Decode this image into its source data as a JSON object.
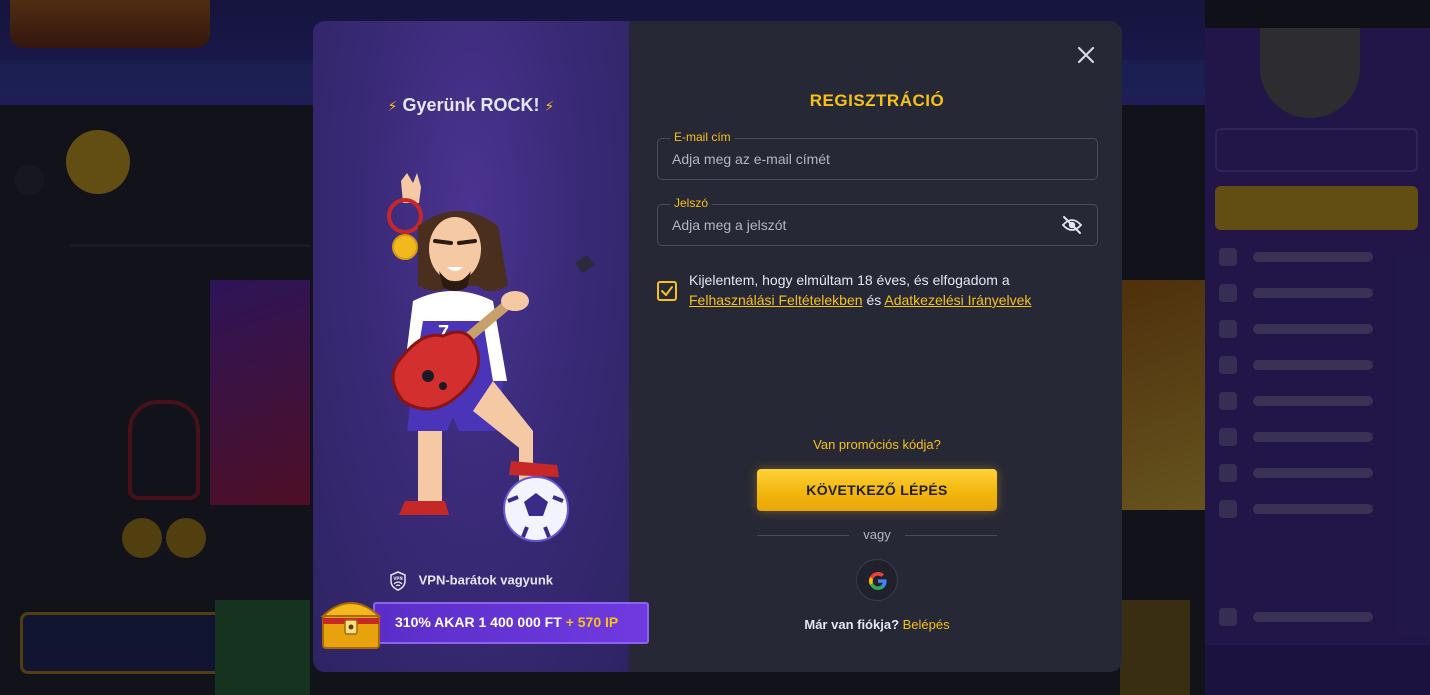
{
  "modal": {
    "close_icon": "close-icon",
    "promo": {
      "title": "Gyerünk ROCK!",
      "vpn_text": "VPN-barátok vagyunk",
      "vpn_icon_label": "VPN",
      "bonus_main": "310% AKAR 1 400 000 FT",
      "bonus_extra": "+ 570 IP"
    },
    "form": {
      "title": "REGISZTRÁCIÓ",
      "email": {
        "label": "E-mail cím",
        "placeholder": "Adja meg az e-mail címét"
      },
      "password": {
        "label": "Jelszó",
        "placeholder": "Adja meg a jelszót",
        "toggle_icon": "eye-off-icon"
      },
      "consent": {
        "checked": true,
        "text": "Kijelentem, hogy elmúltam 18 éves, és elfogadom a",
        "terms_link": "Felhasználási Feltételekben",
        "and": "és",
        "privacy_link": "Adatkezelési Irányelvek"
      },
      "promo_code_link": "Van promóciós kódja?",
      "next_button": "KÖVETKEZŐ LÉPÉS",
      "or_text": "vagy",
      "google_icon": "google-icon",
      "have_account": "Már van fiókja?",
      "login_link": "Belépés"
    }
  },
  "colors": {
    "accent": "#f6c21a",
    "modal_bg": "#272836",
    "promo_panel": "#3a2a78",
    "bonus_bar": "#6a36dc"
  }
}
